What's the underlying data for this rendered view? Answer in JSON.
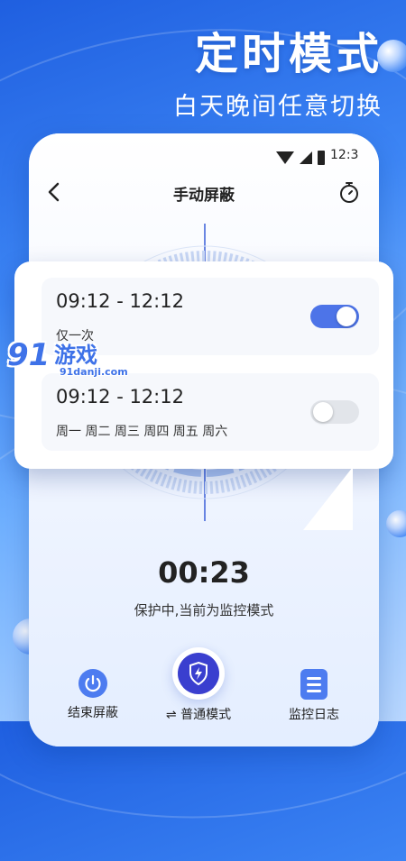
{
  "headline": {
    "title": "定时模式",
    "subtitle": "白天晚间任意切换"
  },
  "status_bar": {
    "time": "12:3"
  },
  "navbar": {
    "back_icon": "chevron-left-icon",
    "title": "手动屏蔽",
    "timer_icon": "stopwatch-icon"
  },
  "schedules": [
    {
      "time_range": "09:12 - 12:12",
      "repeat": "仅一次",
      "enabled": true
    },
    {
      "time_range": "09:12 - 12:12",
      "repeat": "周一 周二 周三 周四 周五 周六",
      "enabled": false
    }
  ],
  "countdown": "00:23",
  "status_text": "保护中,当前为监控模式",
  "bottom_actions": {
    "end": {
      "icon": "power-icon",
      "label": "结束屏蔽"
    },
    "mode": {
      "icon": "shield-lightning-icon",
      "label": "⇌ 普通模式"
    },
    "log": {
      "icon": "document-list-icon",
      "label": "监控日志"
    }
  },
  "watermark": {
    "number": "91",
    "text": "游戏",
    "site": "91danji.com"
  },
  "colors": {
    "accent": "#4d74e8",
    "primary_blue": "#3a3fcf",
    "background": "#3d86f5"
  }
}
